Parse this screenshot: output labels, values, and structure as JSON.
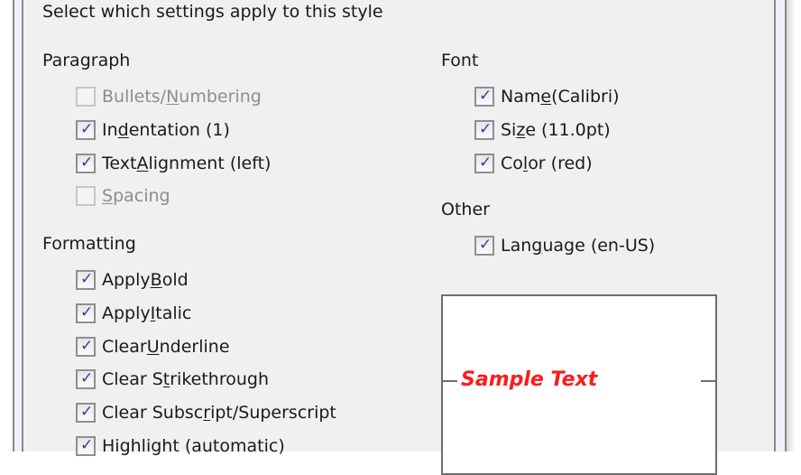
{
  "dialog": {
    "instruction": "Select which settings apply to this style",
    "paragraph": {
      "heading": "Paragraph",
      "items": [
        {
          "parts": [
            "Bullets/",
            "N",
            "umbering"
          ],
          "checked": false,
          "enabled": false
        },
        {
          "parts": [
            "In",
            "d",
            "entation (1)"
          ],
          "checked": true,
          "enabled": true
        },
        {
          "parts": [
            "Text ",
            "A",
            "lignment (left)"
          ],
          "checked": true,
          "enabled": true
        },
        {
          "parts": [
            "",
            "S",
            "pacing"
          ],
          "checked": false,
          "enabled": false
        }
      ]
    },
    "formatting": {
      "heading": "Formatting",
      "items": [
        {
          "parts": [
            "Apply ",
            "B",
            "old"
          ],
          "checked": true,
          "enabled": true
        },
        {
          "parts": [
            "Apply ",
            "I",
            "talic"
          ],
          "checked": true,
          "enabled": true
        },
        {
          "parts": [
            "Clear ",
            "U",
            "nderline"
          ],
          "checked": true,
          "enabled": true
        },
        {
          "parts": [
            "Clear S",
            "t",
            "rikethrough"
          ],
          "checked": true,
          "enabled": true
        },
        {
          "parts": [
            "Clear Subsc",
            "r",
            "ipt/Superscript"
          ],
          "checked": true,
          "enabled": true
        },
        {
          "parts": [
            "Highlight (automatic)",
            "",
            ""
          ],
          "checked": true,
          "enabled": true
        }
      ]
    },
    "font": {
      "heading": "Font",
      "items": [
        {
          "parts": [
            "Nam",
            "e",
            " (Calibri)"
          ],
          "checked": true,
          "enabled": true
        },
        {
          "parts": [
            "Si",
            "z",
            "e (11.0pt)"
          ],
          "checked": true,
          "enabled": true
        },
        {
          "parts": [
            "Co",
            "l",
            "or (red)"
          ],
          "checked": true,
          "enabled": true
        }
      ]
    },
    "other": {
      "heading": "Other",
      "items": [
        {
          "parts": [
            "Lan",
            "g",
            "uage (en-US)"
          ],
          "checked": true,
          "enabled": true
        }
      ]
    },
    "preview": {
      "sample_text": "Sample Text",
      "sample_color": "#ff1a1a"
    },
    "check_glyph": "✓"
  }
}
